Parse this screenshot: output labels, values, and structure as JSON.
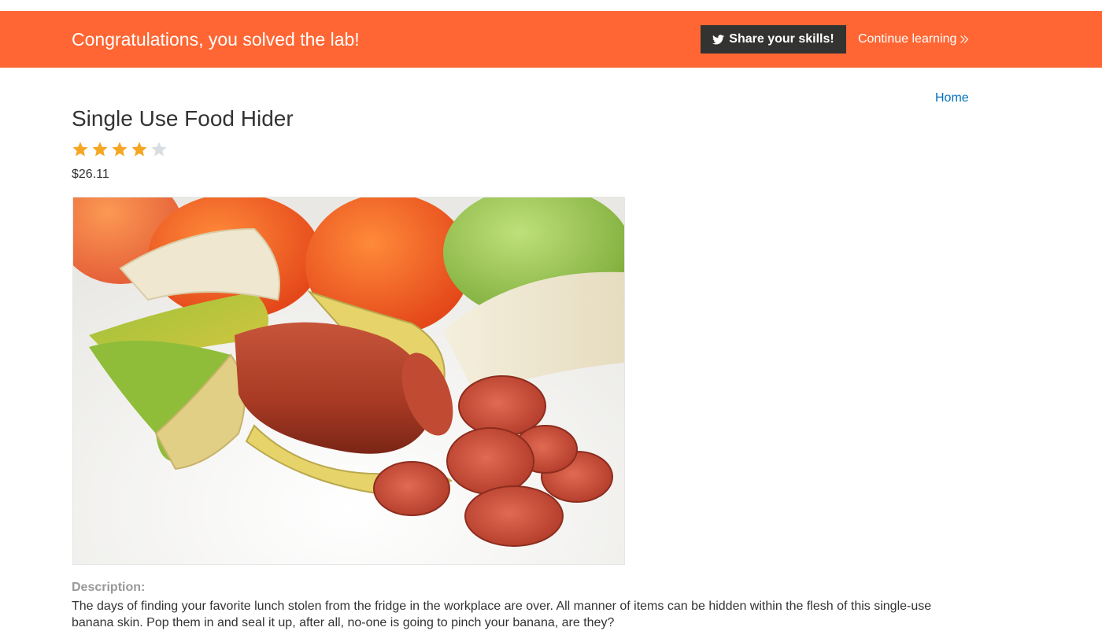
{
  "banner": {
    "message": "Congratulations, you solved the lab!",
    "share_label": "Share your skills!",
    "share_icon": "twitter-bird-icon",
    "continue_label": "Continue learning",
    "continue_icon": "double-chevron-right-icon",
    "color": "#ff6633"
  },
  "nav": {
    "home_label": "Home"
  },
  "product": {
    "title": "Single Use Food Hider",
    "rating": {
      "value": 4,
      "max": 5
    },
    "price": "$26.11",
    "image_icon": "product-photo",
    "description_label": "Description:",
    "description": "The days of finding your favorite lunch stolen from the fridge in the workplace are over. All manner of items can be hidden within the flesh of this single-use banana skin. Pop them in and seal it up, after all, no-one is going to pinch your banana, are they?"
  },
  "colors": {
    "accent": "#ff6633",
    "link": "#0071bc",
    "star_filled": "#f5a623",
    "star_empty": "#d8dde3",
    "text": "#333332"
  }
}
